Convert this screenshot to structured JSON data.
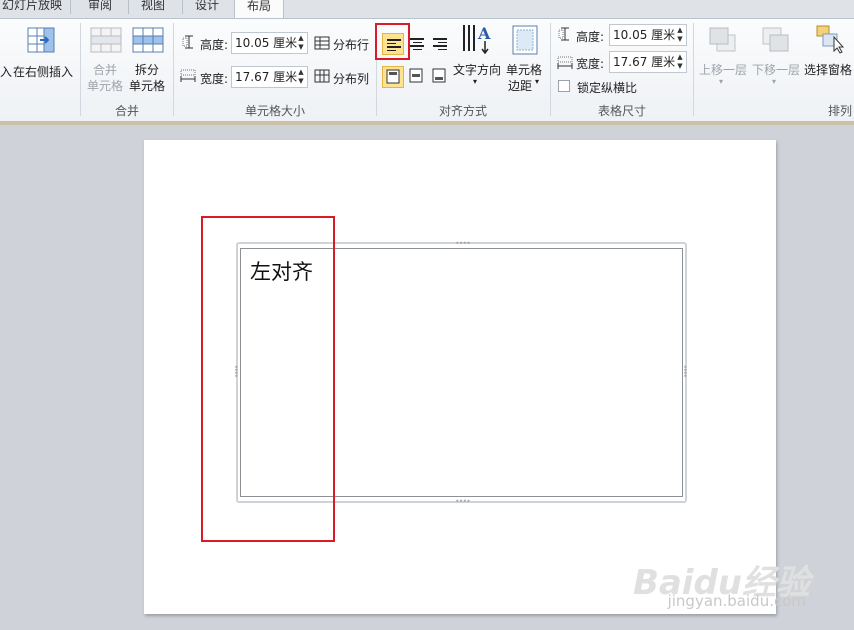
{
  "tabs": [
    "幻灯片放映",
    "审阅",
    "视图",
    "设计",
    "布局"
  ],
  "commands": {
    "insert_left_partial": "入",
    "insert_right": "在右侧插入",
    "merge_cells_line1": "合并",
    "merge_cells_line2": "单元格",
    "split_cells_line1": "拆分",
    "split_cells_line2": "单元格",
    "distribute_rows": "分布行",
    "distribute_cols": "分布列",
    "text_direction": "文字方向",
    "cell_margin_line1": "单元格",
    "cell_margin_line2": "边距",
    "lock_aspect": "锁定纵横比",
    "bring_forward": "上移一层",
    "send_backward": "下移一层",
    "selection_pane": "选择窗格"
  },
  "cell_size": {
    "height_label": "高度:",
    "height_value": "10.05 厘米",
    "width_label": "宽度:",
    "width_value": "17.67 厘米"
  },
  "table_size": {
    "height_label": "高度:",
    "height_value": "10.05 厘米",
    "width_label": "宽度:",
    "width_value": "17.67 厘米"
  },
  "groups": [
    "合并",
    "单元格大小",
    "对齐方式",
    "表格尺寸",
    "排列"
  ],
  "slide": {
    "cell_text": "左对齐"
  },
  "watermark": {
    "main": "Baidu经验",
    "sub": "jingyan.baidu.com"
  },
  "colors": {
    "highlight": "#d81b26",
    "active_button": "#fde38f"
  }
}
